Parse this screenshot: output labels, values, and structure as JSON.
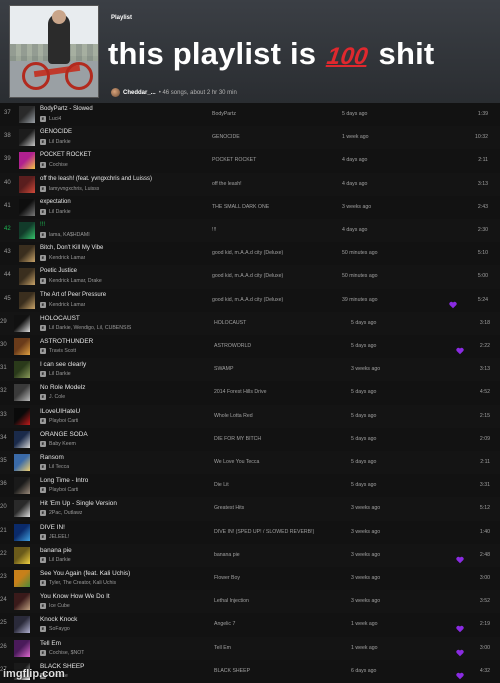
{
  "header": {
    "type_label": "Playlist",
    "title_before": "this playlist is",
    "title_emoji": "100",
    "title_after": "shit",
    "owner": "Cheddar_...",
    "meta": "• 46 songs, about 2 hr 30 min"
  },
  "colors": {
    "accent_purple": "#8a2be2",
    "emoji_red": "#e0282e",
    "background": "#121212"
  },
  "tracks": [
    {
      "num": "37",
      "title": "BodyPartz - Slowed",
      "artist": "Luci4",
      "album": "BodyPartz",
      "added": "5 days ago",
      "duration": "1:39",
      "liked": false,
      "explicit": true,
      "thumb": [
        "#2a2a2a",
        "#9aa0a6"
      ],
      "batch": 1
    },
    {
      "num": "38",
      "title": "GENOCIDE",
      "artist": "Lil Darkie",
      "album": "GENOCIDE",
      "added": "1 week ago",
      "duration": "10:32",
      "liked": false,
      "explicit": true,
      "thumb": [
        "#1c1c1c",
        "#c9c9c9"
      ],
      "batch": 1
    },
    {
      "num": "39",
      "title": "POCKET ROCKET",
      "artist": "Cochise",
      "album": "POCKET ROCKET",
      "added": "4 days ago",
      "duration": "2:11",
      "liked": false,
      "explicit": true,
      "thumb": [
        "#b0208f",
        "#f5c542"
      ],
      "batch": 1
    },
    {
      "num": "40",
      "title": "off the leash! (feat. yvngxchris and Luisss)",
      "artist": "lamyvngxchris, Luisss",
      "album": "off the leash!",
      "added": "4 days ago",
      "duration": "3:13",
      "liked": false,
      "explicit": true,
      "thumb": [
        "#5a1e1e",
        "#d24a3a"
      ],
      "batch": 1
    },
    {
      "num": "41",
      "title": "expectation",
      "artist": "Lil Darkie",
      "album": "THE SMALL DARK ONE",
      "added": "3 weeks ago",
      "duration": "2:43",
      "liked": false,
      "explicit": true,
      "thumb": [
        "#0e0e0e",
        "#7a7a7a"
      ],
      "batch": 1
    },
    {
      "num": "42",
      "title": "!!!",
      "artist": "lama, KA$HDAMI",
      "album": "!!!",
      "added": "4 days ago",
      "duration": "2:30",
      "liked": false,
      "explicit": true,
      "thumb": [
        "#123b2a",
        "#36c26b"
      ],
      "batch": 1,
      "green": true
    },
    {
      "num": "43",
      "title": "Bitch, Don't Kill My Vibe",
      "artist": "Kendrick Lamar",
      "album": "good kid, m.A.A.d city (Deluxe)",
      "added": "50 minutes ago",
      "duration": "5:10",
      "liked": false,
      "explicit": true,
      "thumb": [
        "#3a2e1e",
        "#caa46a"
      ],
      "batch": 1
    },
    {
      "num": "44",
      "title": "Poetic Justice",
      "artist": "Kendrick Lamar, Drake",
      "album": "good kid, m.A.A.d city (Deluxe)",
      "added": "50 minutes ago",
      "duration": "5:00",
      "liked": false,
      "explicit": true,
      "thumb": [
        "#3a2e1e",
        "#caa46a"
      ],
      "batch": 1
    },
    {
      "num": "45",
      "title": "The Art of Peer Pressure",
      "artist": "Kendrick Lamar",
      "album": "good kid, m.A.A.d city (Deluxe)",
      "added": "39 minutes ago",
      "duration": "5:24",
      "liked": true,
      "explicit": true,
      "thumb": [
        "#3a2e1e",
        "#caa46a"
      ],
      "batch": 1
    },
    {
      "num": "29",
      "title": "HOLOCAUST",
      "artist": "Lil Darkie, Wendigo, Lil, CUBENSIS",
      "album": "HOLOCAUST",
      "added": "5 days ago",
      "duration": "3:18",
      "liked": false,
      "explicit": true,
      "thumb": [
        "#111111",
        "#e0e0e0"
      ],
      "batch": 2
    },
    {
      "num": "30",
      "title": "ASTROTHUNDER",
      "artist": "Travis Scott",
      "album": "ASTROWORLD",
      "added": "5 days ago",
      "duration": "2:22",
      "liked": true,
      "explicit": true,
      "thumb": [
        "#6a3b1a",
        "#e0a040"
      ],
      "batch": 2
    },
    {
      "num": "31",
      "title": "I can see clearly",
      "artist": "Lil Darkie",
      "album": "SWAMP",
      "added": "3 weeks ago",
      "duration": "3:13",
      "liked": false,
      "explicit": true,
      "thumb": [
        "#2a3a1a",
        "#8a9a5a"
      ],
      "batch": 2
    },
    {
      "num": "32",
      "title": "No Role Modelz",
      "artist": "J. Cole",
      "album": "2014 Forest Hills Drive",
      "added": "5 days ago",
      "duration": "4:52",
      "liked": false,
      "explicit": true,
      "thumb": [
        "#3a3a3a",
        "#bbbbbb"
      ],
      "batch": 2
    },
    {
      "num": "33",
      "title": "ILoveUIHateU",
      "artist": "Playboi Carti",
      "album": "Whole Lotta Red",
      "added": "5 days ago",
      "duration": "2:15",
      "liked": false,
      "explicit": true,
      "thumb": [
        "#0a0a0a",
        "#c21a1a"
      ],
      "batch": 2
    },
    {
      "num": "34",
      "title": "ORANGE SODA",
      "artist": "Baby Keem",
      "album": "DIE FOR MY BITCH",
      "added": "5 days ago",
      "duration": "2:09",
      "liked": false,
      "explicit": true,
      "thumb": [
        "#1a2a4a",
        "#d8d8d8"
      ],
      "batch": 2
    },
    {
      "num": "35",
      "title": "Ransom",
      "artist": "Lil Tecca",
      "album": "We Love You Tecca",
      "added": "5 days ago",
      "duration": "2:11",
      "liked": false,
      "explicit": true,
      "thumb": [
        "#3a6aa8",
        "#f0d070"
      ],
      "batch": 2
    },
    {
      "num": "36",
      "title": "Long Time - Intro",
      "artist": "Playboi Carti",
      "album": "Die Lit",
      "added": "5 days ago",
      "duration": "3:31",
      "liked": false,
      "explicit": true,
      "thumb": [
        "#1a1a1a",
        "#9a8a7a"
      ],
      "batch": 2
    },
    {
      "num": "20",
      "title": "Hit 'Em Up - Single Version",
      "artist": "2Pac, Outlawz",
      "album": "Greatest Hits",
      "added": "3 weeks ago",
      "duration": "5:12",
      "liked": false,
      "explicit": true,
      "thumb": [
        "#2a2a2a",
        "#e0e0e0"
      ],
      "batch": 2
    },
    {
      "num": "21",
      "title": "DIVE IN!",
      "artist": "JELEEL!",
      "album": "DIVE IN! (SPED UP! / SLOWED REVERB!)",
      "added": "3 weeks ago",
      "duration": "1:40",
      "liked": false,
      "explicit": true,
      "thumb": [
        "#0a2a6a",
        "#40a0e0"
      ],
      "batch": 2
    },
    {
      "num": "22",
      "title": "banana pie",
      "artist": "Lil Darkie",
      "album": "banana pie",
      "added": "3 weeks ago",
      "duration": "2:48",
      "liked": true,
      "explicit": true,
      "thumb": [
        "#6a5a1a",
        "#f0d040"
      ],
      "batch": 2
    },
    {
      "num": "23",
      "title": "See You Again (feat. Kali Uchis)",
      "artist": "Tyler, The Creator, Kali Uchis",
      "album": "Flower Boy",
      "added": "3 weeks ago",
      "duration": "3:00",
      "liked": false,
      "explicit": true,
      "thumb": [
        "#c8801a",
        "#4a8a3a"
      ],
      "batch": 2
    },
    {
      "num": "24",
      "title": "You Know How We Do It",
      "artist": "Ice Cube",
      "album": "Lethal Injection",
      "added": "3 weeks ago",
      "duration": "3:52",
      "liked": false,
      "explicit": true,
      "thumb": [
        "#3a1a1a",
        "#c0a080"
      ],
      "batch": 2
    },
    {
      "num": "25",
      "title": "Knock Knock",
      "artist": "SoFaygo",
      "album": "Angelic 7",
      "added": "1 week ago",
      "duration": "2:19",
      "liked": true,
      "explicit": true,
      "thumb": [
        "#2a2a3a",
        "#b0b0d0"
      ],
      "batch": 2
    },
    {
      "num": "26",
      "title": "Tell Em",
      "artist": "Cochise, $NOT",
      "album": "Tell Em",
      "added": "1 week ago",
      "duration": "3:00",
      "liked": true,
      "explicit": true,
      "thumb": [
        "#4a1a5a",
        "#e06ad0"
      ],
      "batch": 2
    },
    {
      "num": "27",
      "title": "BLACK SHEEP",
      "artist": "Cochise",
      "album": "BLACK SHEEP",
      "added": "6 days ago",
      "duration": "4:32",
      "liked": true,
      "explicit": true,
      "thumb": [
        "#1a1a1a",
        "#ffffff"
      ],
      "batch": 2
    }
  ],
  "watermark": "imgflip.com"
}
